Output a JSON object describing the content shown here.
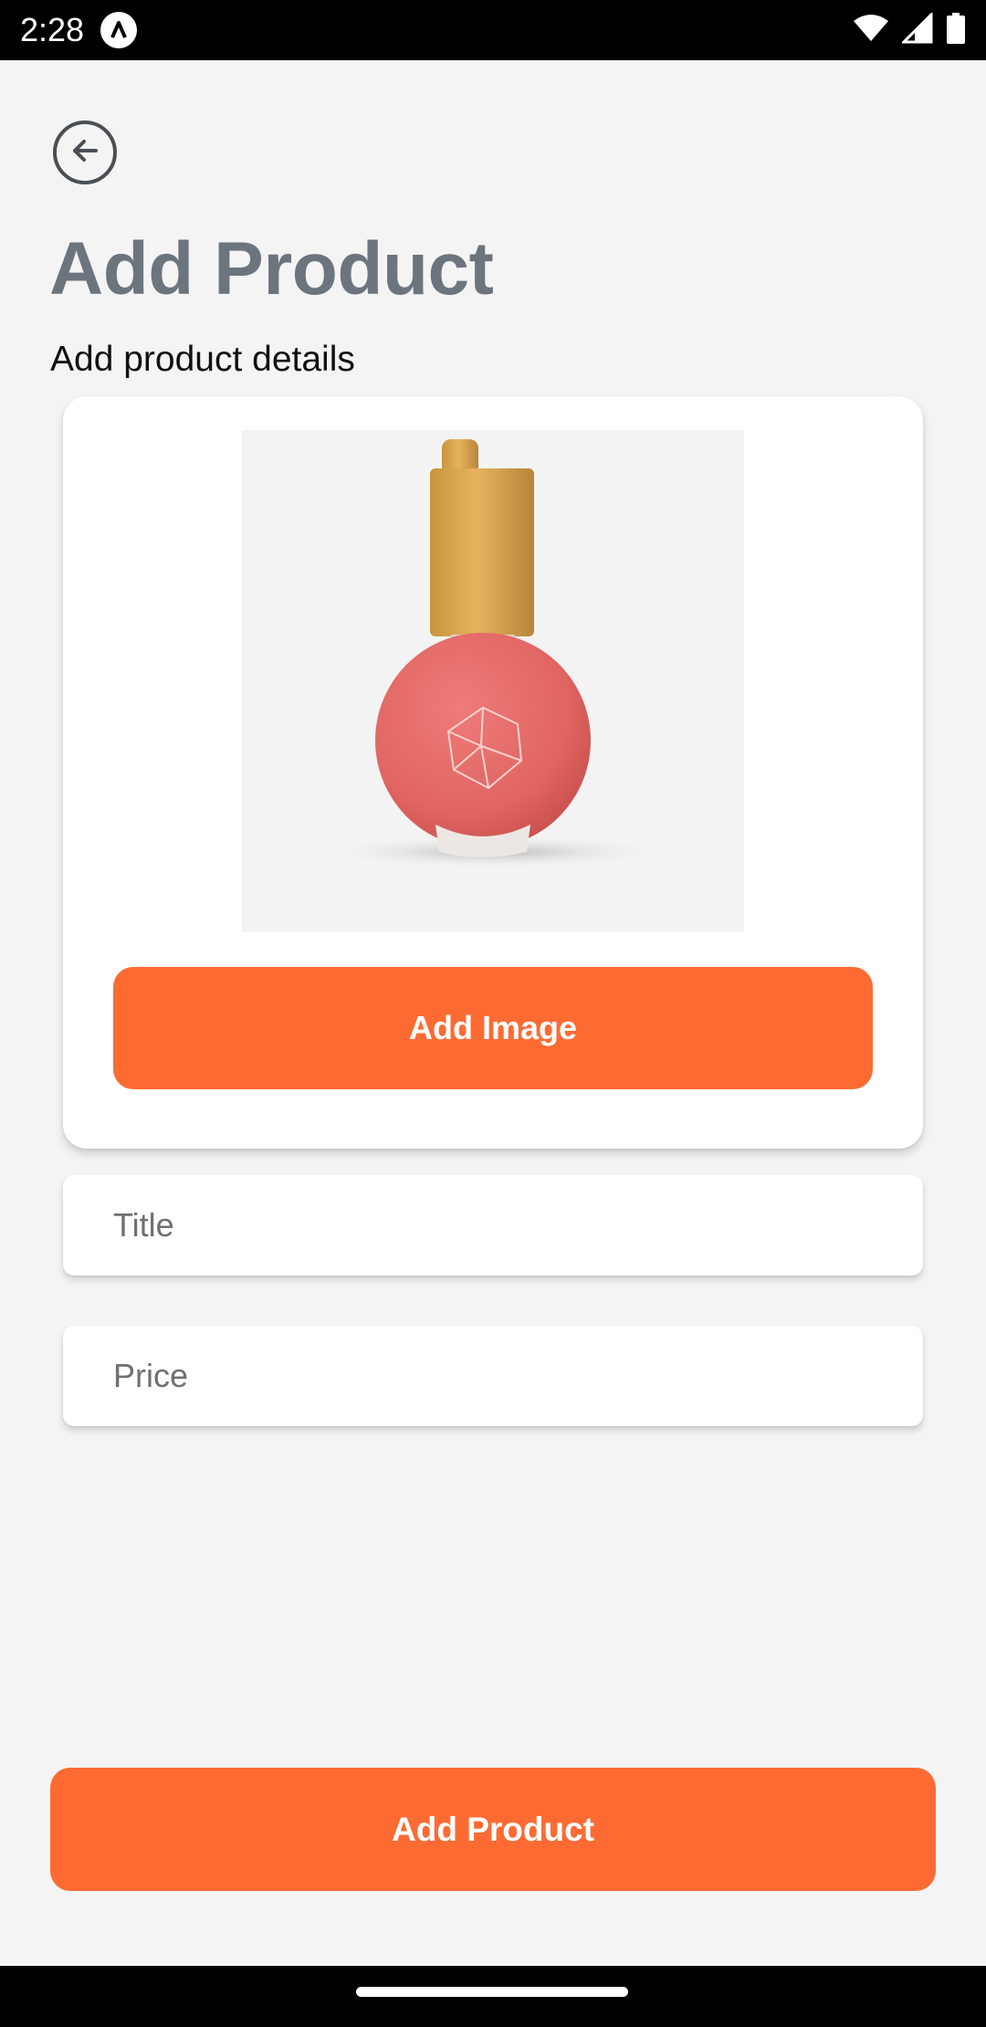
{
  "status_bar": {
    "time": "2:28",
    "icons": [
      "app-notification-icon",
      "wifi-icon",
      "cell-signal-icon",
      "battery-icon"
    ]
  },
  "header": {
    "back_icon": "arrow-left-circle-icon",
    "title": "Add Product",
    "subtitle": "Add product details"
  },
  "image_card": {
    "image_desc_icon": "product-bottle-image",
    "add_image_label": "Add Image"
  },
  "form": {
    "title_placeholder": "Title",
    "price_placeholder": "Price"
  },
  "footer": {
    "submit_label": "Add Product"
  },
  "colors": {
    "accent": "#fd6b33",
    "title_text": "#6c747e",
    "background": "#f4f4f4"
  }
}
